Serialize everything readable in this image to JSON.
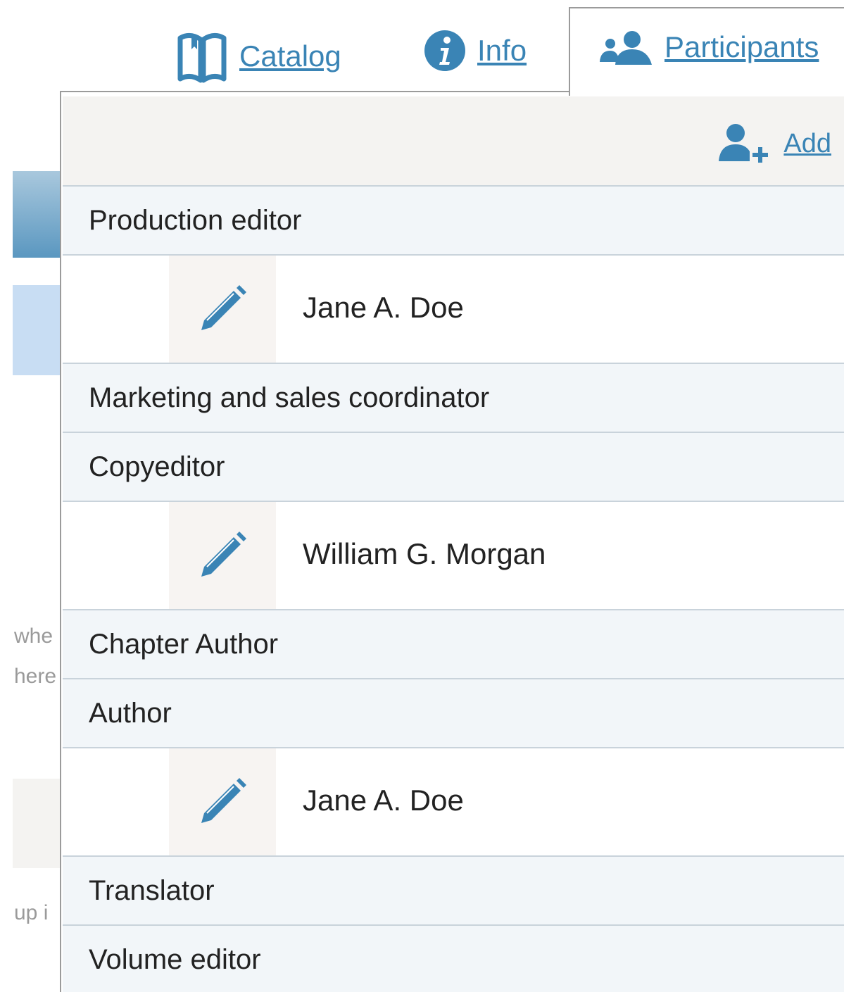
{
  "tabs": [
    {
      "label": "Catalog",
      "icon": "book-icon"
    },
    {
      "label": "Info",
      "icon": "info-icon"
    },
    {
      "label": "Participants",
      "icon": "users-icon",
      "active": true
    }
  ],
  "toolbar": {
    "add_label": "Add",
    "add_icon": "add-user-icon"
  },
  "roles": [
    {
      "label": "Production editor",
      "participants": [
        "Jane A. Doe"
      ]
    },
    {
      "label": "Marketing and sales coordinator",
      "participants": []
    },
    {
      "label": "Copyeditor",
      "participants": [
        "William G. Morgan"
      ]
    },
    {
      "label": "Chapter Author",
      "participants": []
    },
    {
      "label": "Author",
      "participants": [
        "Jane A. Doe"
      ]
    },
    {
      "label": "Translator",
      "participants": []
    },
    {
      "label": "Volume editor",
      "participants": []
    }
  ],
  "background_fragments": [
    "whe",
    "here",
    "up i"
  ],
  "colors": {
    "link": "#3a84b5",
    "role_row_bg": "#f2f6f9",
    "toolbar_bg": "#f4f3f1",
    "edit_cell_bg": "#f7f4f2"
  }
}
